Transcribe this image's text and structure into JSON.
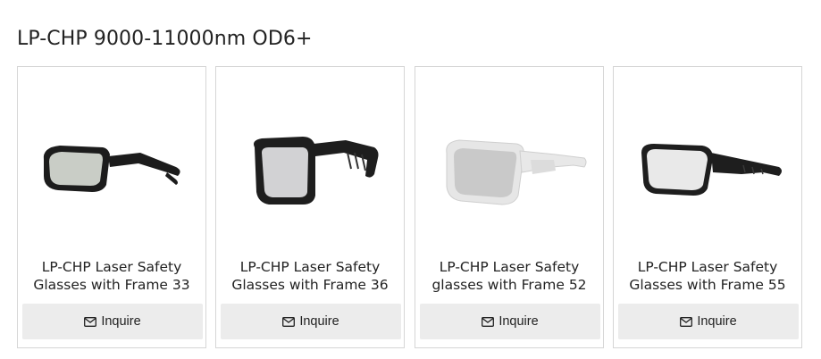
{
  "section": {
    "title": "LP-CHP 9000-11000nm OD6+"
  },
  "products": [
    {
      "title": "LP-CHP Laser Safety Glasses with Frame 33",
      "image_icon": "black-wraparound-glasses",
      "frame_color": "#1c1c1c",
      "lens_color": "#c9cdc6",
      "inquire_label": "Inquire"
    },
    {
      "title": "LP-CHP Laser Safety Glasses with Frame 36",
      "image_icon": "black-overspec-glasses",
      "frame_color": "#1e1e1e",
      "lens_color": "#d2d2d4",
      "inquire_label": "Inquire"
    },
    {
      "title": "LP-CHP Laser Safety glasses with Frame 52",
      "image_icon": "white-wraparound-glasses",
      "frame_color": "#e6e6e6",
      "lens_color": "#c9c9c9",
      "inquire_label": "Inquire"
    },
    {
      "title": "LP-CHP Laser Safety Glasses with Frame 55",
      "image_icon": "black-sport-glasses",
      "frame_color": "#1e1e1e",
      "lens_color": "#e9e9e9",
      "inquire_label": "Inquire"
    }
  ]
}
